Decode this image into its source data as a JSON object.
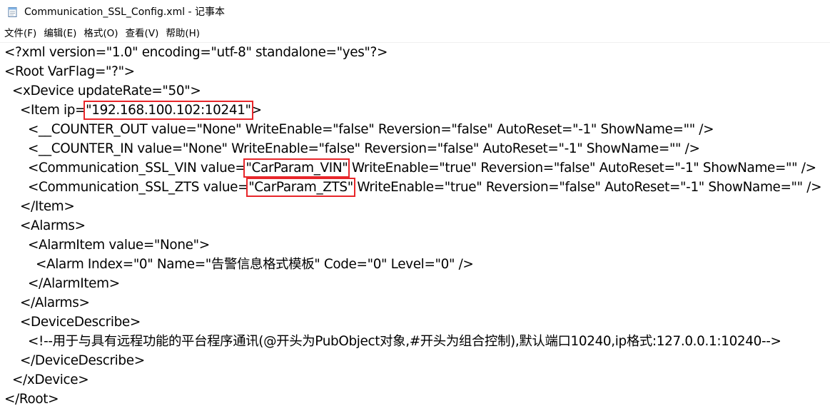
{
  "window": {
    "icon": "notepad-icon",
    "title": "Communication_SSL_Config.xml - 记事本"
  },
  "menu": {
    "items": [
      "文件(F)",
      "编辑(E)",
      "格式(O)",
      "查看(V)",
      "帮助(H)"
    ]
  },
  "highlight_color": "#e8262a",
  "editor": {
    "lines": [
      {
        "indent": "",
        "segments": [
          {
            "text": "<?xml version=\"1.0\" encoding=\"utf-8\" standalone=\"yes\"?>"
          }
        ]
      },
      {
        "indent": "",
        "segments": [
          {
            "text": "<Root VarFlag=\"?\">"
          }
        ]
      },
      {
        "indent": "  ",
        "segments": [
          {
            "text": "<xDevice updateRate=\"50\">"
          }
        ]
      },
      {
        "indent": "    ",
        "segments": [
          {
            "text": "<Item ip="
          },
          {
            "text": "\"192.168.100.102:10241\"",
            "highlight": true
          },
          {
            "text": ">"
          }
        ]
      },
      {
        "indent": "      ",
        "segments": [
          {
            "text": "<__COUNTER_OUT value=\"None\" WriteEnable=\"false\" Reversion=\"false\" AutoReset=\"-1\" ShowName=\"\" />"
          }
        ]
      },
      {
        "indent": "      ",
        "segments": [
          {
            "text": "<__COUNTER_IN value=\"None\" WriteEnable=\"false\" Reversion=\"false\" AutoReset=\"-1\" ShowName=\"\" />"
          }
        ]
      },
      {
        "indent": "      ",
        "segments": [
          {
            "text": "<Communication_SSL_VIN value="
          },
          {
            "text": "\"CarParam_VIN\"",
            "highlight": true
          },
          {
            "text": " WriteEnable=\"true\" Reversion=\"false\" AutoReset=\"-1\" ShowName=\"\" />"
          }
        ]
      },
      {
        "indent": "      ",
        "segments": [
          {
            "text": "<Communication_SSL_ZTS value="
          },
          {
            "text": "\"CarParam_ZTS\"",
            "highlight": true
          },
          {
            "text": " WriteEnable=\"true\" Reversion=\"false\" AutoReset=\"-1\" ShowName=\"\" />"
          }
        ]
      },
      {
        "indent": "    ",
        "segments": [
          {
            "text": "</Item>"
          }
        ]
      },
      {
        "indent": "    ",
        "segments": [
          {
            "text": "<Alarms>"
          }
        ]
      },
      {
        "indent": "      ",
        "segments": [
          {
            "text": "<AlarmItem value=\"None\">"
          }
        ]
      },
      {
        "indent": "        ",
        "segments": [
          {
            "text": "<Alarm Index=\"0\" Name=\"告警信息格式模板\" Code=\"0\" Level=\"0\" />"
          }
        ]
      },
      {
        "indent": "      ",
        "segments": [
          {
            "text": "</AlarmItem>"
          }
        ]
      },
      {
        "indent": "    ",
        "segments": [
          {
            "text": "</Alarms>"
          }
        ]
      },
      {
        "indent": "    ",
        "segments": [
          {
            "text": "<DeviceDescribe>"
          }
        ]
      },
      {
        "indent": "      ",
        "segments": [
          {
            "text": "<!--用于与具有远程功能的平台程序通讯(@开头为PubObject对象,#开头为组合控制),默认端口10240,ip格式:127.0.0.1:10240-->"
          }
        ]
      },
      {
        "indent": "    ",
        "segments": [
          {
            "text": "</DeviceDescribe>"
          }
        ]
      },
      {
        "indent": "  ",
        "segments": [
          {
            "text": "</xDevice>"
          }
        ]
      },
      {
        "indent": "",
        "segments": [
          {
            "text": "</Root>"
          }
        ]
      }
    ]
  }
}
